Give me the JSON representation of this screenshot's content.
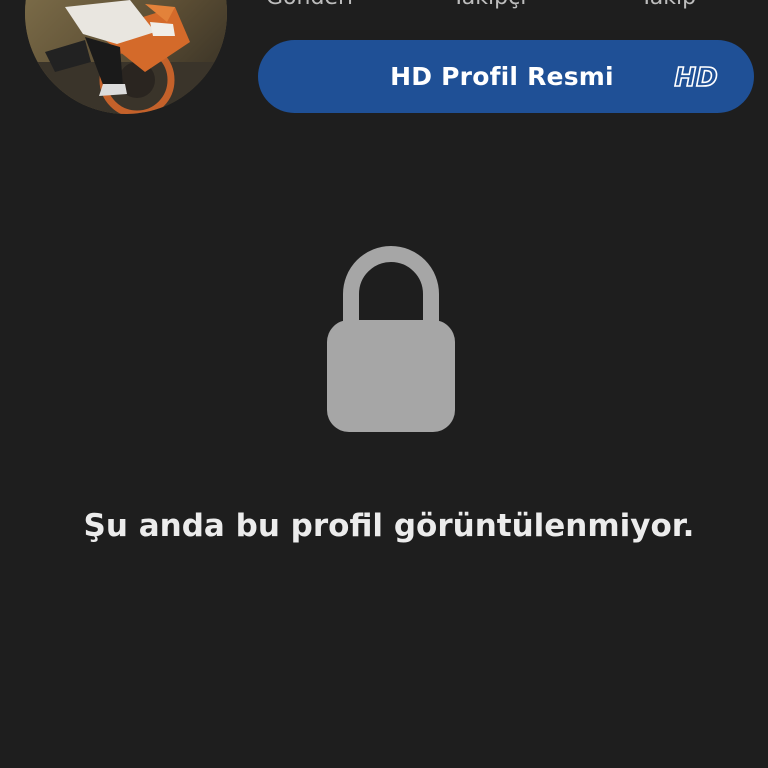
{
  "header": {
    "stats": {
      "posts_label": "Gönderi",
      "followers_label": "Takipçi",
      "following_label": "Takip"
    },
    "hd_button": {
      "label": "HD Profil Resmi",
      "badge_text": "HD",
      "color": "#1f5096"
    }
  },
  "avatar": {
    "icon": "profile-photo-motorcycle"
  },
  "main": {
    "lock_icon": "lock-icon",
    "lock_color": "#a6a6a6",
    "message": "Şu anda bu profil görüntülenmiyor."
  },
  "colors": {
    "background": "#1e1e1e",
    "text": "#ececec"
  }
}
